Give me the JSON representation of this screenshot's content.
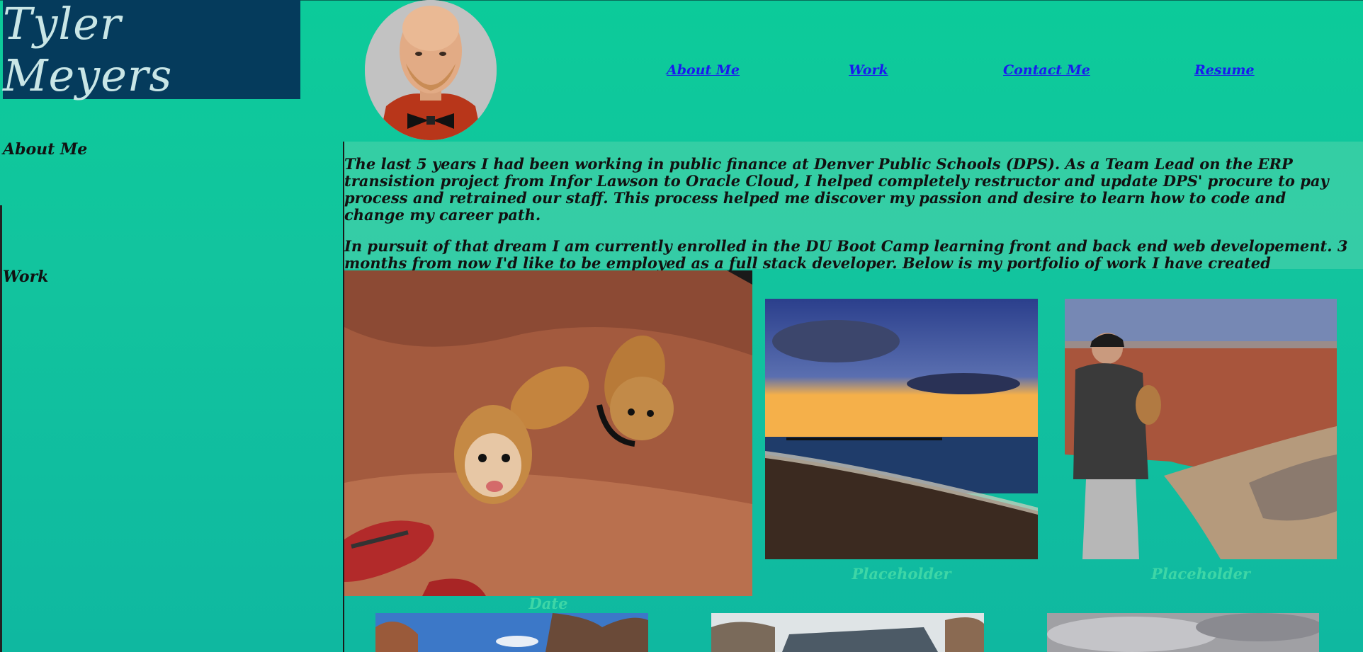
{
  "header": {
    "name": "Tyler Meyers"
  },
  "nav": {
    "about": "About Me",
    "work": "Work",
    "contact": "Contact Me",
    "resume": "Resume"
  },
  "sidebar": {
    "about_label": "About Me",
    "work_label": "Work"
  },
  "about": {
    "paragraph1": "The last 5 years I had been working in public finance at Denver Public Schools (DPS). As a Team Lead on the ERP transistion project from Infor Lawson to Oracle Cloud, I helped completely restructor and update DPS' procure to pay process and retrained our staff. This process helped me discover my passion and desire to learn how to code and change my career path.",
    "paragraph2": "In pursuit of that dream I am currently enrolled in the DU Boot Camp learning front and back end web developement. 3 months from now I'd like to be employed as a full stack developer. Below is my portfolio of work I have created throughtout this jouney."
  },
  "work": {
    "captions": [
      "Date",
      "Placeholder",
      "Placeholder"
    ]
  },
  "colors": {
    "page_background": "#0ccb9a",
    "header_background": "#053b5c",
    "header_text": "#c9e6e6",
    "link": "#1a1aee",
    "caption": "#3ed6a6"
  }
}
